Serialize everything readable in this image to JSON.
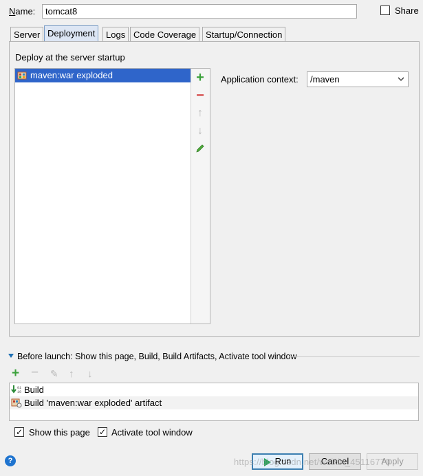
{
  "name": {
    "label_prefix": "N",
    "label_rest": "ame:",
    "value": "tomcat8"
  },
  "share": {
    "label": "Share",
    "checked": false
  },
  "tabs": [
    {
      "label": "Server",
      "active": false
    },
    {
      "label": "Deployment",
      "active": true
    },
    {
      "label": "Logs",
      "active": false
    },
    {
      "label": "Code Coverage",
      "active": false
    },
    {
      "label": "Startup/Connection",
      "active": false
    }
  ],
  "deployment": {
    "section_title": "Deploy at the server startup",
    "items": [
      {
        "label": "maven:war exploded",
        "selected": true,
        "icon": "war-artifact-icon"
      }
    ],
    "toolbar": [
      "add-icon",
      "remove-icon",
      "move-up-icon",
      "move-down-icon",
      "edit-icon"
    ],
    "app_context": {
      "label": "Application context:",
      "value": "/maven"
    }
  },
  "before_launch": {
    "title": "Before launch: Show this page, Build, Build Artifacts, Activate tool window",
    "title_underline_char": "B",
    "tasks": [
      {
        "label": "Build",
        "icon": "build-icon"
      },
      {
        "label": "Build 'maven:war exploded' artifact",
        "icon": "artifact-icon"
      }
    ]
  },
  "options": {
    "show_page": {
      "label": "Show this page",
      "checked": true
    },
    "activate_tool": {
      "label": "Activate tool window",
      "checked": true
    }
  },
  "buttons": {
    "run": "Run",
    "cancel": "Cancel",
    "apply": "Apply"
  },
  "watermark": "https://blog.csdn.net/weixin_45116770",
  "colors": {
    "selection": "#2f65ca",
    "accent": "#3aa13a",
    "active_tab": "#dde6f4"
  }
}
